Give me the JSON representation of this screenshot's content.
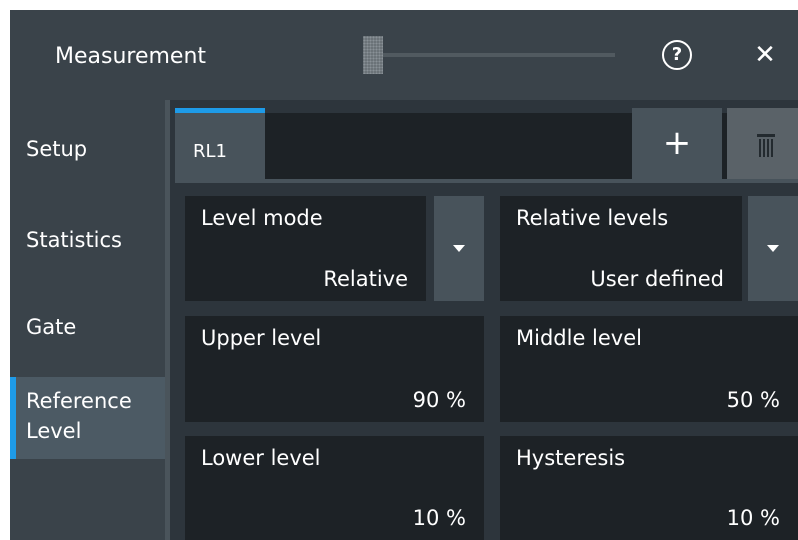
{
  "window": {
    "title": "Measurement",
    "help_label": "?",
    "close_label": "✕"
  },
  "sidebar": {
    "items": [
      {
        "label": "Setup"
      },
      {
        "label": "Statistics"
      },
      {
        "label": "Gate"
      },
      {
        "label": "Reference Level",
        "active": true
      }
    ]
  },
  "tabs": {
    "items": [
      {
        "label": "RL1",
        "active": true
      }
    ],
    "add_label": "+"
  },
  "settings": {
    "level_mode": {
      "label": "Level mode",
      "value": "Relative"
    },
    "relative_levels": {
      "label": "Relative levels",
      "value": "User defined"
    },
    "upper_level": {
      "label": "Upper level",
      "value": "90 %"
    },
    "middle_level": {
      "label": "Middle level",
      "value": "50 %"
    },
    "lower_level": {
      "label": "Lower level",
      "value": "10 %"
    },
    "hysteresis": {
      "label": "Hysteresis",
      "value": "10 %"
    }
  },
  "colors": {
    "accent": "#1e9be8",
    "background": "#2d353c",
    "panel": "#3a434a",
    "cell": "#1d2226"
  }
}
